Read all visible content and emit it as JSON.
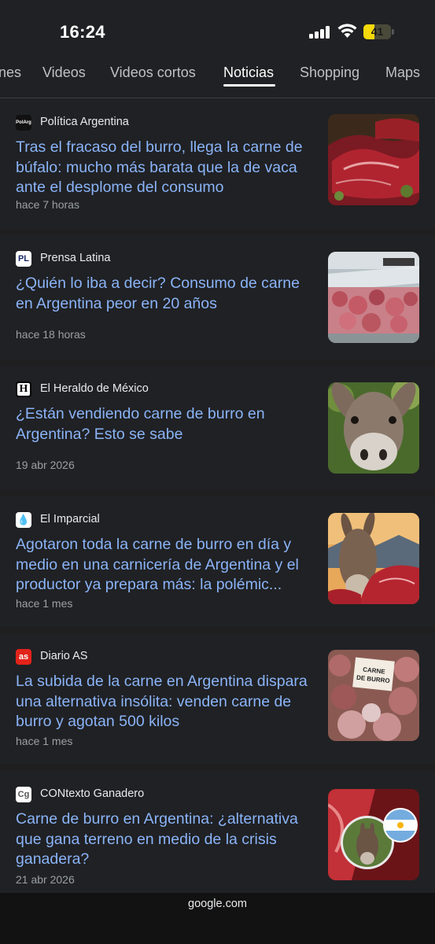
{
  "status_bar": {
    "time": "16:24",
    "battery": "41",
    "battery_level": 0.41
  },
  "tabs": [
    {
      "label": "nes"
    },
    {
      "label": "Videos"
    },
    {
      "label": "Videos cortos"
    },
    {
      "label": "Noticias",
      "active": true
    },
    {
      "label": "Shopping"
    },
    {
      "label": "Maps"
    }
  ],
  "articles": [
    {
      "source": "Política Argentina",
      "favicon": "PolArg",
      "headline": "Tras el fracaso del burro, llega la carne de búfalo: mucho más barata que la de vaca ante el desplome del consumo",
      "time": "hace 7 horas",
      "thumb": "raw-beef-image"
    },
    {
      "source": "Prensa Latina",
      "favicon": "PL",
      "headline": "¿Quién lo iba a decir? Consumo de carne en Argentina peor en 20 años",
      "time": "hace 18 horas",
      "thumb": "butcher-counter-image"
    },
    {
      "source": "El Heraldo de México",
      "favicon": "H",
      "headline": "¿Están vendiendo carne de burro en Argentina? Esto se sabe",
      "time": "19 abr 2026",
      "thumb": "donkey-face-image"
    },
    {
      "source": "El Imparcial",
      "favicon": "flame",
      "headline": "Agotaron toda la carne de burro en día y medio en una carnicería de Argentina y el productor ya prepara más: la polémic...",
      "time": "hace 1 mes",
      "thumb": "donkey-with-meat-image"
    },
    {
      "source": "Diario AS",
      "favicon": "as",
      "headline": "La subida de la carne en Argentina dispara una alternativa insólita: venden carne de burro y agotan 500 kilos",
      "time": "hace 1 mes",
      "thumb": "carne-de-burro-sign-image",
      "thumb_text": "CARNE DE BURRO"
    },
    {
      "source": "CONtexto Ganadero",
      "favicon": "Cg",
      "headline": "Carne de burro en Argentina: ¿alternativa que gana terreno en medio de la crisis ganadera?",
      "time": "21 abr 2026",
      "thumb": "donkey-argentina-flag-image"
    }
  ],
  "footer": {
    "url": "google.com"
  },
  "colors": {
    "headline": "#8ab4f8",
    "background": "#1f1f1f",
    "card": "#202124",
    "meta": "#9aa0a6"
  }
}
